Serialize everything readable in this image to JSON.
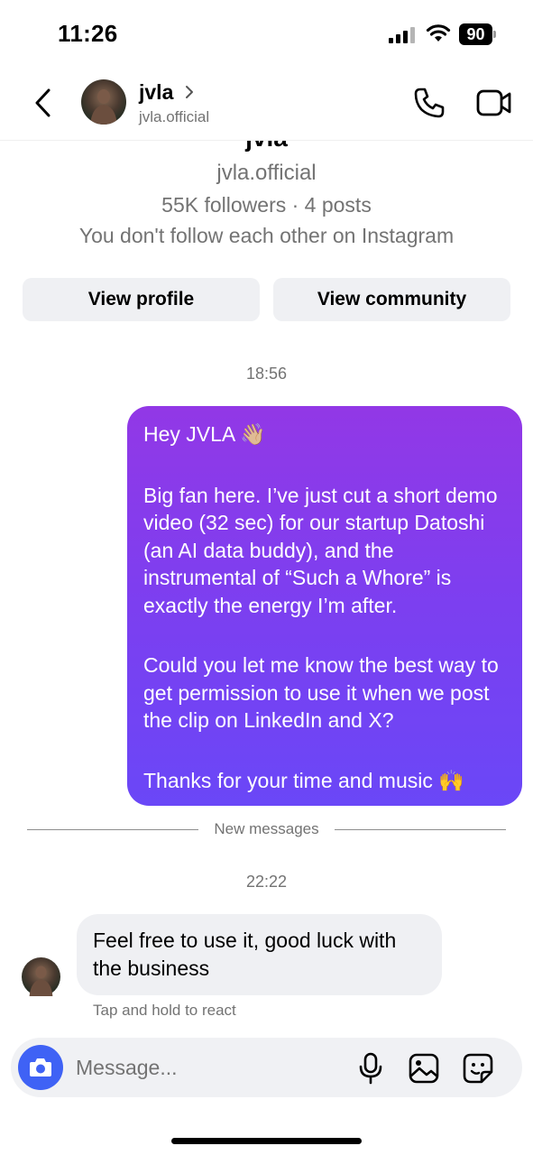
{
  "status_bar": {
    "time": "11:26",
    "battery": "90",
    "icons": [
      "signal-icon",
      "wifi-icon",
      "battery-icon"
    ]
  },
  "header": {
    "name": "jvla",
    "handle": "jvla.official",
    "icons": [
      "back-icon",
      "chevron-right-icon",
      "phone-icon",
      "video-camera-icon"
    ]
  },
  "profile": {
    "name_cutoff": "jvla",
    "handle": "jvla.official",
    "stats": "55K followers · 4 posts",
    "follow_status": "You don't follow each other on Instagram",
    "view_profile_label": "View profile",
    "view_community_label": "View community"
  },
  "thread": {
    "timestamp_1": "18:56",
    "sent_message": {
      "greeting": "Hey JVLA",
      "greeting_emoji": "👋🏼",
      "paragraph_1": "Big fan here. I’ve just cut a short demo video (32 sec) for our startup Datoshi (an AI data buddy), and the instrumental of “Such a Whore” is exactly the energy I’m after.",
      "paragraph_2": "Could you let me know the best way to get permission to use it when we post the clip on LinkedIn and X?",
      "closing": "Thanks for your time and music",
      "closing_emoji": "🙌"
    },
    "new_messages_label": "New messages",
    "timestamp_2": "22:22",
    "received_message": "Feel free to use it, good luck with the business",
    "react_hint": "Tap and hold to react"
  },
  "composer": {
    "placeholder": "Message...",
    "icons": [
      "camera-icon",
      "microphone-icon",
      "gallery-icon",
      "sticker-icon"
    ]
  },
  "colors": {
    "sent_bubble_top": "#9238e6",
    "sent_bubble_bottom": "#6a47f7",
    "camera_button": "#3f62f5",
    "secondary_text": "#737373",
    "gray_surface": "#eff0f3"
  }
}
